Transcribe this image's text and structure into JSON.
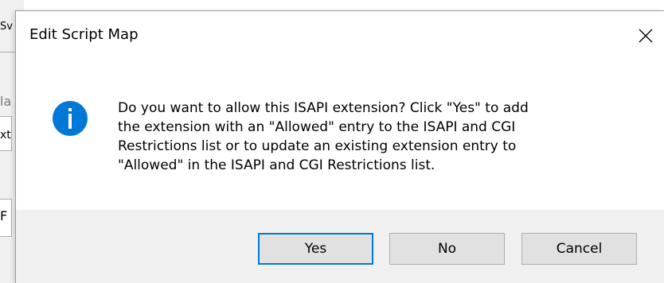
{
  "background_window": {
    "fragments": [
      "Sv",
      "la",
      "xt",
      "F"
    ]
  },
  "dialog": {
    "title": "Edit Script Map",
    "close_icon": "close-icon",
    "info_icon": "info-icon",
    "message_lines": [
      "Do you want to allow this ISAPI extension? Click \"Yes\" to add",
      "the extension with an \"Allowed\" entry to the ISAPI and CGI",
      "Restrictions list or to update an existing extension entry to",
      "\"Allowed\" in the ISAPI and CGI Restrictions list."
    ],
    "buttons": {
      "yes": "Yes",
      "no": "No",
      "cancel": "Cancel"
    },
    "colors": {
      "info_blue": "#0078d7",
      "footer_bg": "#f0f0f0",
      "button_bg": "#e1e1e1",
      "default_button_border": "#0078d7"
    }
  }
}
